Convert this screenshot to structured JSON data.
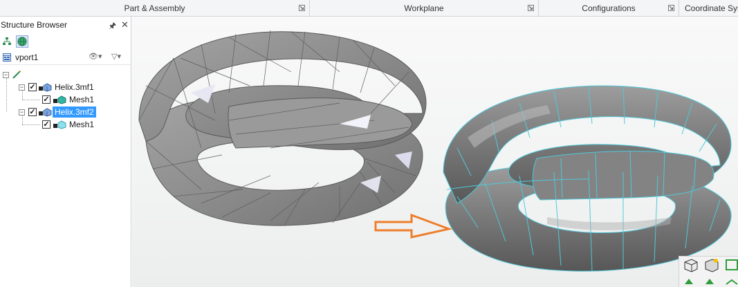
{
  "ribbon": {
    "groups": [
      {
        "label": "Part & Assembly"
      },
      {
        "label": "Workplane"
      },
      {
        "label": "Configurations"
      },
      {
        "label": "Coordinate Sys"
      }
    ]
  },
  "browser": {
    "title": "Structure Browser",
    "pin_icon": "pin-icon",
    "close_icon": "close-icon",
    "viewport_name": "vport1",
    "tree": [
      {
        "label": "Helix.3mf1",
        "checked": true,
        "selected": false,
        "children": [
          {
            "label": "Mesh1",
            "checked": true
          }
        ]
      },
      {
        "label": "Helix.3mf2",
        "checked": true,
        "selected": true,
        "children": [
          {
            "label": "Mesh1",
            "checked": true
          }
        ]
      }
    ]
  },
  "viewport": {
    "arrow_color": "#ee7d2a",
    "mesh_edge_color": "#4fc9da",
    "model_fill": "#8f8f8f"
  }
}
